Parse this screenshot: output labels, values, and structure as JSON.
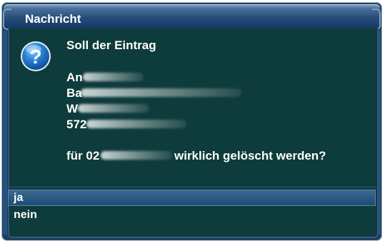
{
  "dialog": {
    "title": "Nachricht",
    "icon": "question-icon",
    "message": {
      "line1": "Soll der Eintrag",
      "name_prefix": "An",
      "street_prefix": "Ba",
      "city_prefix": "W",
      "zip_prefix": "572",
      "number_prefix": "für 02",
      "confirm_suffix": "wirklich gelöscht werden?"
    },
    "options": [
      {
        "label": "ja",
        "selected": true
      },
      {
        "label": "nein",
        "selected": false
      }
    ]
  },
  "colors": {
    "title_bar": "#284f7c",
    "content_bg": "#0e3b3b",
    "selection": "#2b5a83",
    "text": "#ffffff"
  }
}
